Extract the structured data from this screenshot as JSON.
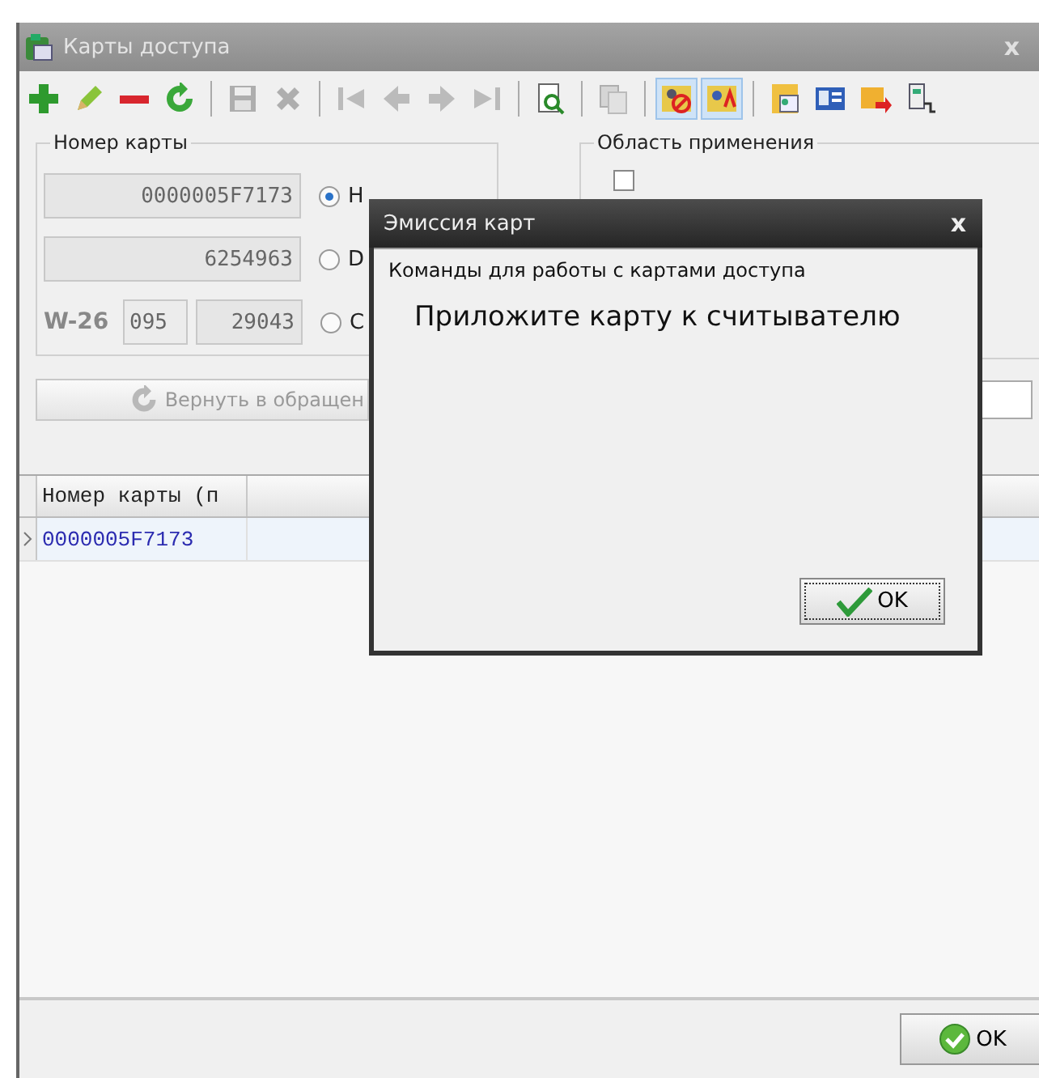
{
  "window": {
    "title": "Карты доступа",
    "close": "x"
  },
  "toolbar": [
    [
      {
        "kind": "add",
        "disabled": false,
        "selected": false
      },
      {
        "kind": "edit",
        "disabled": false,
        "selected": false
      },
      {
        "kind": "remove",
        "disabled": false,
        "selected": false
      },
      {
        "kind": "refresh",
        "disabled": false,
        "selected": false
      }
    ],
    [
      {
        "kind": "save",
        "disabled": true,
        "selected": false
      },
      {
        "kind": "cancel",
        "disabled": true,
        "selected": false
      }
    ],
    [
      {
        "kind": "first",
        "disabled": true,
        "selected": false
      },
      {
        "kind": "prev",
        "disabled": true,
        "selected": false
      },
      {
        "kind": "next",
        "disabled": true,
        "selected": false
      },
      {
        "kind": "last",
        "disabled": true,
        "selected": false
      }
    ],
    [
      {
        "kind": "inspect",
        "disabled": false,
        "selected": false
      }
    ],
    [
      {
        "kind": "copy",
        "disabled": true,
        "selected": false
      }
    ],
    [
      {
        "kind": "person-block",
        "disabled": false,
        "selected": true
      },
      {
        "kind": "person-letter",
        "disabled": false,
        "selected": true
      }
    ],
    [
      {
        "kind": "card-folder",
        "disabled": false,
        "selected": false
      },
      {
        "kind": "id-card",
        "disabled": false,
        "selected": false
      },
      {
        "kind": "card-export",
        "disabled": false,
        "selected": false
      },
      {
        "kind": "reader",
        "disabled": false,
        "selected": false
      }
    ]
  ],
  "card_number_group": {
    "title": "Номер карты",
    "rows": [
      {
        "kind": "hex",
        "value": "0000005F7173",
        "option": "Н",
        "selected": true
      },
      {
        "kind": "dec",
        "value": "6254963",
        "option": "D",
        "selected": false
      },
      {
        "kind": "w26",
        "prefix": "W-26",
        "facility": "095",
        "value": "29043",
        "option": "С",
        "selected": false
      }
    ]
  },
  "scope_group": {
    "title": "Область применения",
    "checked": false
  },
  "restore_button": "Вернуть в обращен",
  "grid": {
    "columns": [
      "Номер карты (п"
    ],
    "rows": [
      {
        "cells": [
          "0000005F7173"
        ],
        "selected": true
      }
    ]
  },
  "ok_button": "OK",
  "dialog": {
    "title": "Эмиссия карт",
    "close": "x",
    "subtitle": "Команды для работы с картами доступа",
    "message": "Приложите карту к считывателю",
    "ok_button": "OK"
  }
}
